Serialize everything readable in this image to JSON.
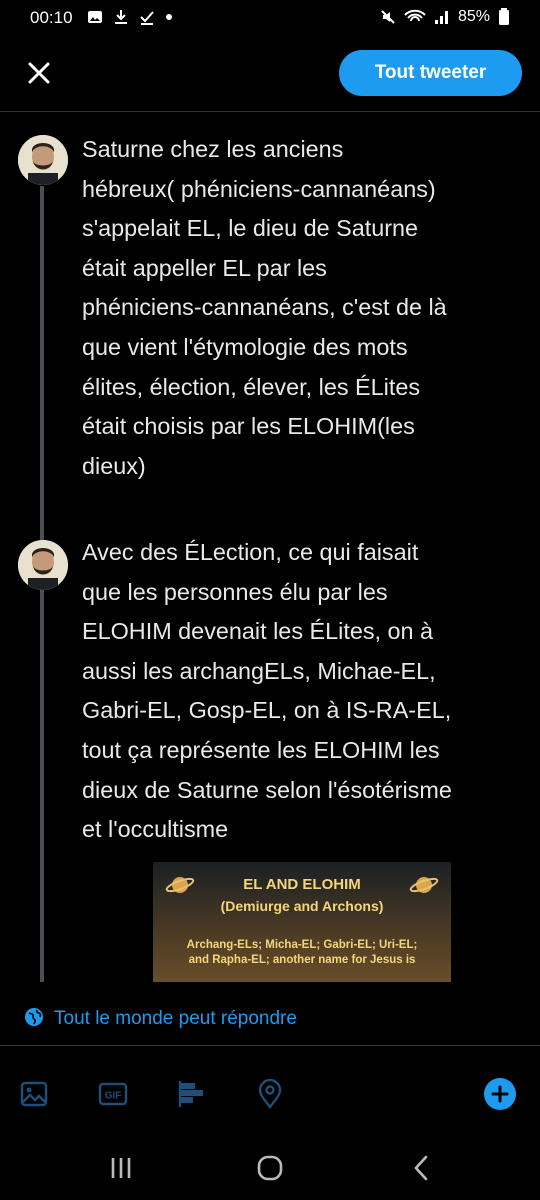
{
  "status": {
    "time": "00:10",
    "battery": "85%",
    "left_icons": [
      "image-icon",
      "download-icon",
      "check-icon",
      "dot-icon"
    ],
    "right_icons": [
      "mute-icon",
      "wifi-icon",
      "signal-icon",
      "battery-icon"
    ]
  },
  "topbar": {
    "close_icon": "close-icon",
    "tweet_all_label": "Tout tweeter"
  },
  "thread": {
    "tweets": [
      {
        "text": "Saturne chez les anciens\nhébreux( phéniciens-cannanéans)\ns'appelait EL, le dieu de Saturne\nétait appeller EL par les\nphéniciens-cannanéans, c'est de là\nque vient l'étymologie des mots\nélites, élection, élever, les ÉLites\nétait choisis par les ELOHIM(les\ndieux)"
      },
      {
        "text": "Avec des ÉLection, ce qui faisait\nque les personnes élu par les\nELOHIM devenait les ÉLites, on à\naussi les archangELs, Michae-EL,\nGabri-EL, Gosp-EL, on à IS-RA-EL,\ntout ça représente les ELOHIM les\ndieux de Saturne selon l'ésotérisme\net l'occultisme"
      }
    ],
    "media": {
      "title": "EL AND ELOHIM",
      "subtitle": "(Demiurge and Archons)",
      "body": "Archang-ELs; Micha-EL; Gabri-EL; Uri-EL;\nand Rapha-EL; another name for Jesus is"
    }
  },
  "reply_setting": {
    "label": "Tout le monde peut répondre",
    "icon": "globe-icon"
  },
  "toolbar": {
    "tools": [
      "image-icon",
      "gif-icon",
      "poll-icon",
      "location-icon",
      "add-icon"
    ]
  },
  "navbar": {
    "buttons": [
      "recent-apps-icon",
      "home-icon",
      "back-icon"
    ]
  },
  "colors": {
    "accent": "#1d9bf0",
    "background": "#000000",
    "text": "#e7e9ea",
    "thread_line": "#4a4f54"
  }
}
